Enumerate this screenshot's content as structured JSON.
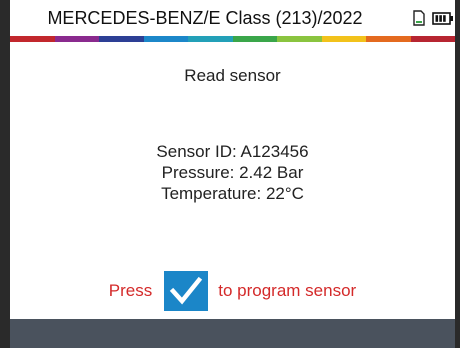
{
  "header": {
    "title": "MERCEDES-BENZ/E Class (213)/2022",
    "icons": [
      "sd-card-icon",
      "battery-icon"
    ],
    "strip_colors": [
      "#c2272d",
      "#8a2a8e",
      "#2d3f95",
      "#1c87c9",
      "#23a0b8",
      "#3aa64a",
      "#8ac43f",
      "#f2c21b",
      "#e46a1f",
      "#b72531"
    ]
  },
  "main": {
    "title": "Read sensor",
    "sensor_id": "Sensor ID: A123456",
    "pressure": "Pressure: 2.42 Bar",
    "temperature": "Temperature: 22°C"
  },
  "prompt": {
    "prefix": "Press",
    "suffix": "to program sensor",
    "button_icon": "checkmark-icon",
    "accent_color": "#1b86c8",
    "text_color": "#d42a2a"
  }
}
